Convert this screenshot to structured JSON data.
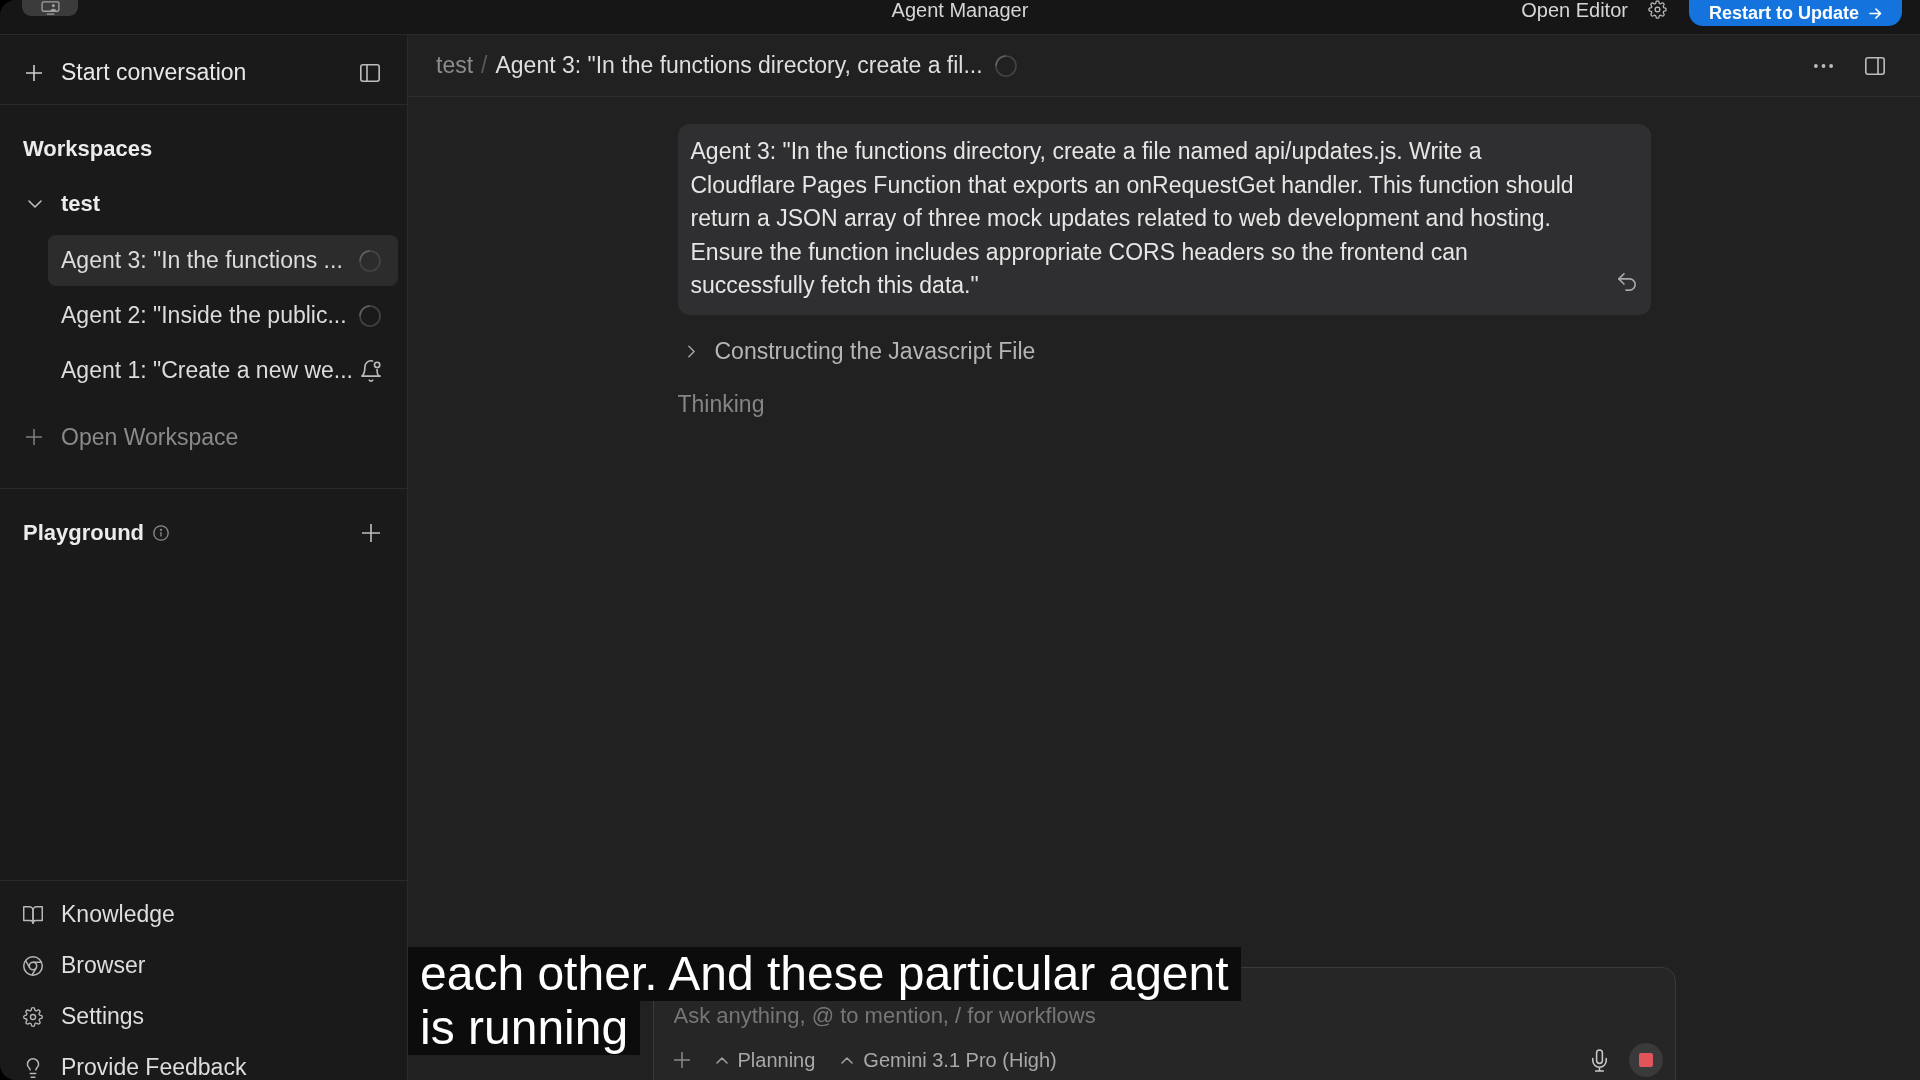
{
  "title_bar": {
    "title": "Agent Manager",
    "open_editor": "Open Editor",
    "update_button": "Restart to Update"
  },
  "sidebar": {
    "start_conversation": "Start conversation",
    "workspaces_heading": "Workspaces",
    "workspaces": [
      {
        "name": "test",
        "expanded": true,
        "children": [
          {
            "title": "Agent 3: \"In the functions ...",
            "selected": true,
            "kind": "running"
          },
          {
            "title": "Agent 2: \"Inside the public...",
            "selected": false,
            "kind": "running"
          },
          {
            "title": "Agent 1: \"Create a new we...",
            "selected": false,
            "kind": "alert"
          }
        ]
      }
    ],
    "open_workspace": "Open Workspace",
    "playground": "Playground",
    "footer_items": [
      "Knowledge",
      "Browser",
      "Settings",
      "Provide Feedback"
    ]
  },
  "conversation": {
    "breadcrumb": {
      "workspace": "test",
      "separator": "/",
      "title": "Agent 3: \"In the functions directory, create a fil...",
      "running": true
    },
    "messages": [
      {
        "kind": "user",
        "text": "Agent 3: \"In the functions directory, create a file named api/updates.js. Write a Cloudflare Pages Function that exports an onRequestGet handler. This function should return a JSON array of three mock updates related to web development and hosting. Ensure the function includes appropriate CORS headers so the frontend can successfully fetch this data.\""
      }
    ],
    "steps": [
      {
        "label": "Constructing the Javascript File",
        "expanded": false
      }
    ],
    "status": "Thinking",
    "composer": {
      "placeholder": "Ask anything, @ to mention, / for workflows",
      "mode": "Planning",
      "model": "Gemini 3.1 Pro (High)",
      "running": true
    }
  },
  "video_caption": {
    "lines": [
      "each other. And these particular agent",
      "is running"
    ]
  }
}
